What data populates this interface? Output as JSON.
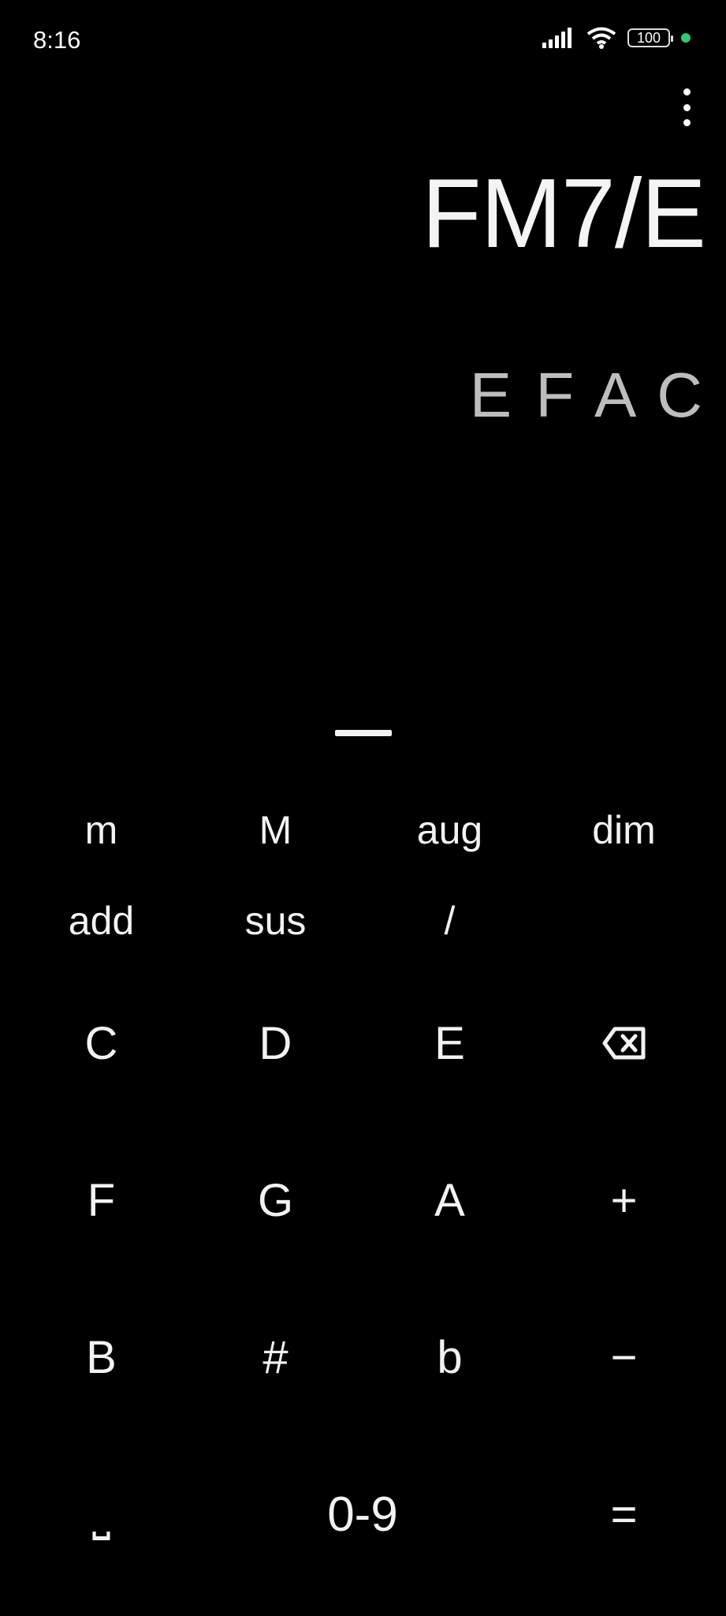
{
  "status_bar": {
    "time": "8:16",
    "battery": "100",
    "icons": [
      "signal-icon",
      "wifi-icon",
      "battery-icon",
      "camera-indicator-icon"
    ],
    "indicator_color": "#2ecc71"
  },
  "display": {
    "chord_name": "FM7/E",
    "chord_notes": "E F A C"
  },
  "keyboard": {
    "modifiers": [
      "m",
      "M",
      "aug",
      "dim",
      "add",
      "sus",
      "/"
    ],
    "notes": {
      "c": "C",
      "d": "D",
      "e": "E",
      "f": "F",
      "g": "G",
      "a": "A",
      "b": "B",
      "sharp": "#",
      "flat": "b",
      "plus": "+",
      "minus": "−",
      "space": "⎵",
      "numbers": "0-9",
      "equals": "="
    },
    "backspace_icon": "backspace-icon"
  },
  "colors": {
    "background": "#000000",
    "text": "#f2f2f2",
    "notes_text": "#bdbdbd"
  }
}
